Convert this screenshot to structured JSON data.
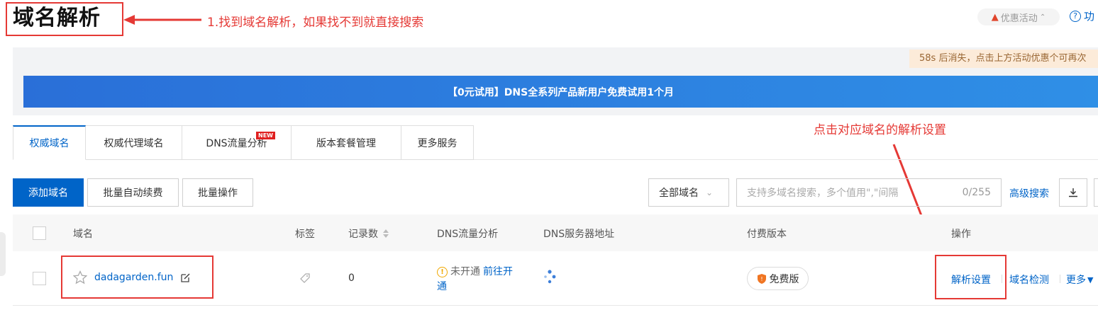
{
  "header": {
    "title": "域名解析",
    "promo_label": "优惠活动",
    "help_label": "功"
  },
  "annotations": {
    "step1": "1.找到域名解析，如果找不到就直接搜索",
    "step2": "点击对应域名的解析设置"
  },
  "notice": {
    "countdown": "58s 后消失，点击上方活动优惠个可再次"
  },
  "banner": {
    "text": "【0元试用】DNS全系列产品新用户免费试用1个月"
  },
  "tabs": [
    {
      "label": "权威域名",
      "active": true
    },
    {
      "label": "权威代理域名",
      "active": false
    },
    {
      "label": "DNS流量分析",
      "active": false,
      "badge": "NEW"
    },
    {
      "label": "版本套餐管理",
      "active": false
    },
    {
      "label": "更多服务",
      "active": false
    }
  ],
  "toolbar": {
    "add_domain": "添加域名",
    "batch_renew": "批量自动续费",
    "batch_ops": "批量操作",
    "filter_value": "全部域名",
    "search_placeholder": "支持多域名搜索，多个值用\",\"间隔",
    "search_count": "0/255",
    "advanced_search": "高级搜索"
  },
  "table": {
    "columns": {
      "domain": "域名",
      "tag": "标签",
      "records": "记录数",
      "dns_traffic": "DNS流量分析",
      "dns_server": "DNS服务器地址",
      "paid_version": "付费版本",
      "actions": "操作"
    },
    "rows": [
      {
        "domain": "dadagarden.fun",
        "records": "0",
        "dns_status": "未开通",
        "dns_link_line1": "前往开",
        "dns_link_line2": "通",
        "version": "免费版",
        "action_resolve": "解析设置",
        "action_check": "域名检测",
        "action_more": "更多"
      }
    ]
  },
  "colors": {
    "accent": "#0064c8",
    "annotation_red": "#e53935",
    "banner_blue": "#2a6fd8"
  }
}
